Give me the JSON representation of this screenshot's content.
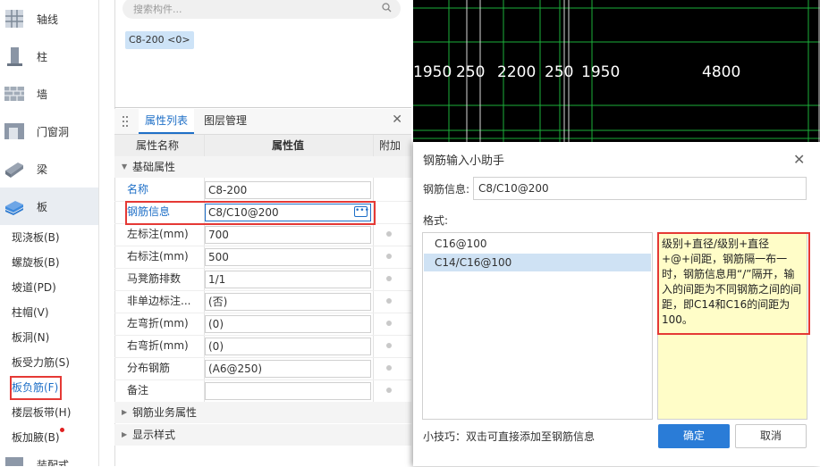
{
  "nav": {
    "categories": [
      {
        "label": "轴线",
        "icon": "grid-axis-icon"
      },
      {
        "label": "柱",
        "icon": "column-icon"
      },
      {
        "label": "墙",
        "icon": "wall-icon"
      },
      {
        "label": "门窗洞",
        "icon": "door-window-icon"
      },
      {
        "label": "梁",
        "icon": "beam-icon"
      },
      {
        "label": "板",
        "icon": "slab-icon"
      }
    ],
    "sub_items": [
      "现浇板(B)",
      "螺旋板(B)",
      "坡道(PD)",
      "柱帽(V)",
      "板洞(N)",
      "板受力筋(S)",
      "板负筋(F)",
      "楼层板带(H)",
      "板加腋(B)"
    ],
    "bottom_partial": "装配式"
  },
  "component_panel": {
    "search_placeholder": "搜索构件...",
    "selected_component": "C8-200 <0>"
  },
  "properties": {
    "tabs": [
      "属性列表",
      "图层管理"
    ],
    "columns": [
      "属性名称",
      "属性值",
      "附加"
    ],
    "section_basic": "基础属性",
    "rows": [
      {
        "name": "名称",
        "value": "C8-200"
      },
      {
        "name": "钢筋信息",
        "value": "C8/C10@200"
      },
      {
        "name": "左标注(mm)",
        "value": "700"
      },
      {
        "name": "右标注(mm)",
        "value": "500"
      },
      {
        "name": "马凳筋排数",
        "value": "1/1"
      },
      {
        "name": "非单边标注...",
        "value": "(否)"
      },
      {
        "name": "左弯折(mm)",
        "value": "(0)"
      },
      {
        "name": "右弯折(mm)",
        "value": "(0)"
      },
      {
        "name": "分布钢筋",
        "value": "(A6@250)"
      },
      {
        "name": "备注",
        "value": ""
      }
    ],
    "section_business": "钢筋业务属性",
    "section_display": "显示样式"
  },
  "cad": {
    "dimensions": [
      "1950",
      "250",
      "2200",
      "250",
      "1950",
      "4800"
    ]
  },
  "dialog": {
    "title": "钢筋输入小助手",
    "info_label": "钢筋信息:",
    "info_value": "C8/C10@200",
    "format_label": "格式:",
    "formats": [
      "C16@100",
      "C14/C16@100"
    ],
    "selected_format": "C14/C16@100",
    "note": "级别+直径/级别+直径+@+间距，钢筋隔一布一时，钢筋信息用“/”隔开，输入的间距为不同钢筋之间的间距，即C14和C16的间距为100。",
    "tip": "小技巧：双击可直接添加至钢筋信息",
    "ok_label": "确定",
    "cancel_label": "取消"
  },
  "colors": {
    "accent": "#2a7cd7",
    "highlight_red": "#e53935",
    "note_bg": "#fffdc8",
    "cad_bg": "#000000",
    "cad_grid": "#1bb13a"
  }
}
